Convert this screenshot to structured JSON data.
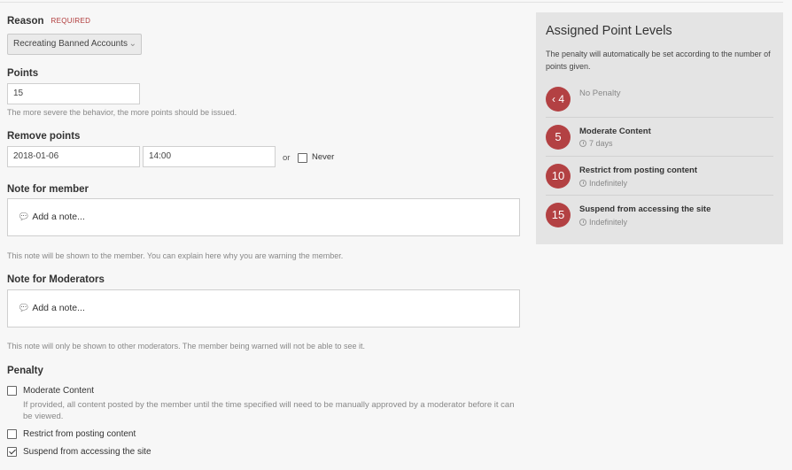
{
  "reason": {
    "label": "Reason",
    "required": "REQUIRED",
    "selected": "Recreating Banned Accounts"
  },
  "points": {
    "label": "Points",
    "value": "15",
    "help": "The more severe the behavior, the more points should be issued."
  },
  "remove_points": {
    "label": "Remove points",
    "date": "2018-01-06",
    "time": "14:00",
    "or": "or",
    "never_label": "Never",
    "never_checked": false
  },
  "note_member": {
    "label": "Note for member",
    "placeholder": "Add a note...",
    "help": "This note will be shown to the member. You can explain here why you are warning the member."
  },
  "note_moderators": {
    "label": "Note for Moderators",
    "placeholder": "Add a note...",
    "help": "This note will only be shown to other moderators. The member being warned will not be able to see it."
  },
  "penalty": {
    "label": "Penalty",
    "options": [
      {
        "label": "Moderate Content",
        "checked": false,
        "description": "If provided, all content posted by the member until the time specified will need to be manually approved by a moderator before it can be viewed."
      },
      {
        "label": "Restrict from posting content",
        "checked": false
      },
      {
        "label": "Suspend from accessing the site",
        "checked": true
      }
    ]
  },
  "sidebar": {
    "title": "Assigned Point Levels",
    "description": "The penalty will automatically be set according to the number of points given.",
    "levels": [
      {
        "badge": "‹ 4",
        "title": "No Penalty",
        "sub": ""
      },
      {
        "badge": "5",
        "title": "Moderate Content",
        "sub": "7 days"
      },
      {
        "badge": "10",
        "title": "Restrict from posting content",
        "sub": "Indefinitely"
      },
      {
        "badge": "15",
        "title": "Suspend from accessing the site",
        "sub": "Indefinitely"
      }
    ]
  },
  "colors": {
    "badge": "#b34143",
    "required": "#b03a3a",
    "panel_bg": "#e4e4e4"
  }
}
